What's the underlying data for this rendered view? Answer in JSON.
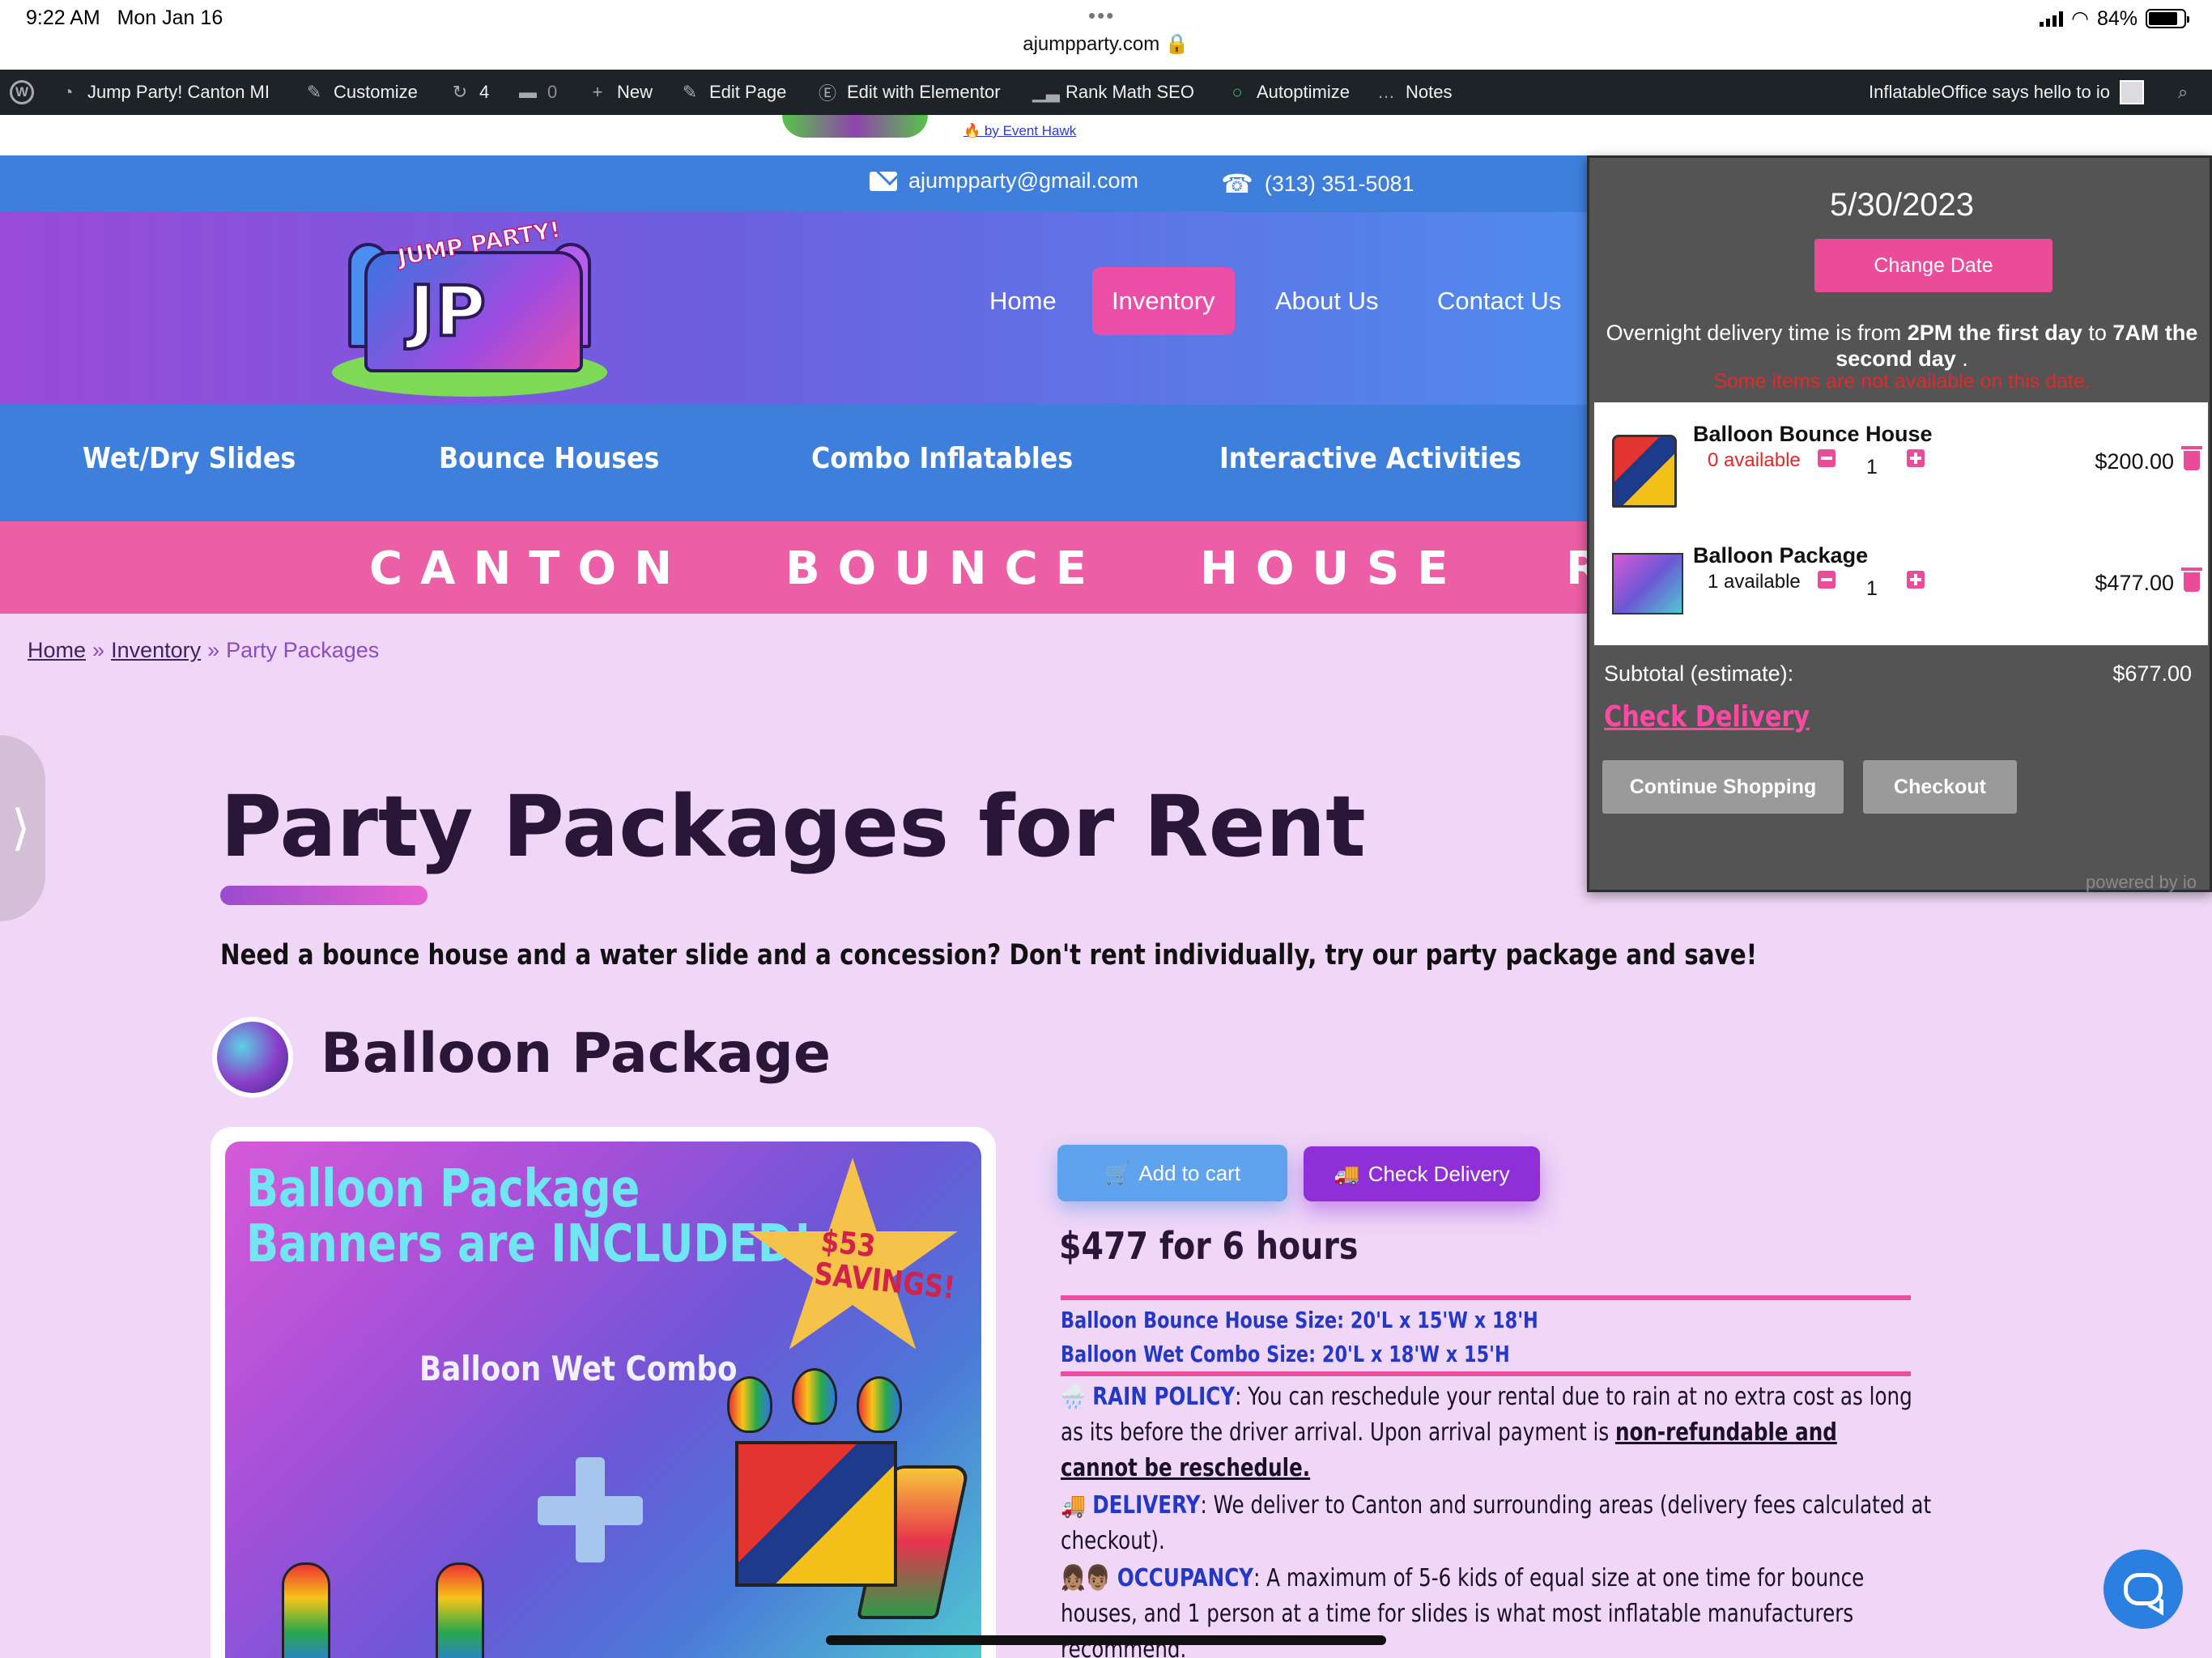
{
  "status_bar": {
    "time": "9:22 AM",
    "date": "Mon Jan 16",
    "url": "ajumpparty.com 🔒",
    "battery": "84%",
    "battery_level": 0.84
  },
  "admin_bar": {
    "site_name": "Jump Party! Canton MI",
    "customize": "Customize",
    "updates_count": "4",
    "comments_count": "0",
    "new": "New",
    "edit_page": "Edit Page",
    "edit_elementor": "Edit with Elementor",
    "rank_math": "Rank Math SEO",
    "autoptimize": "Autoptimize",
    "notes": "Notes",
    "greeting": "InflatableOffice says hello to io"
  },
  "event_hawk": {
    "link": "🔥 by Event Hawk"
  },
  "contact": {
    "email": "ajumpparty@gmail.com",
    "phone": "(313) 351-5081"
  },
  "logo": {
    "arch_text": "JUMP PARTY!",
    "letters": "JP"
  },
  "nav": [
    {
      "label": "Home"
    },
    {
      "label": "Inventory"
    },
    {
      "label": "About Us"
    },
    {
      "label": "Contact Us"
    }
  ],
  "categories": [
    {
      "label": "Wet/Dry Slides"
    },
    {
      "label": "Bounce Houses"
    },
    {
      "label": "Combo Inflatables"
    },
    {
      "label": "Interactive Activities"
    }
  ],
  "marquee": [
    "CANTON",
    "BOUNCE",
    "HOUSE",
    "R"
  ],
  "breadcrumb": {
    "home": "Home",
    "sep1": "»",
    "inventory": "Inventory",
    "sep2": "»",
    "current": "Party Packages"
  },
  "side_tab": {
    "chevron": "⟩"
  },
  "page": {
    "title": "Party Packages for Rent",
    "intro": "Need a bounce house and a water slide and a concession?  Don't rent individually, try our party package and save!"
  },
  "package": {
    "title": "Balloon Package",
    "image": {
      "line1": "Balloon Package",
      "line2": "Banners are INCLUDED!",
      "savings1": "$53",
      "savings2": "SAVINGS!",
      "combo": "Balloon Wet Combo"
    },
    "add_to_cart": "Add to cart",
    "check_delivery": "Check Delivery",
    "price": "$477 for 6 hours",
    "size1": "Balloon Bounce House Size: 20'L x 15'W x 18'H",
    "size2": "Balloon Wet Combo Size: 20'L x 18'W x 15'H",
    "rain_key": "🌧️ RAIN POLICY",
    "rain_text": ": You can reschedule your rental due to rain at no extra cost as long",
    "rain_text2": "as its before the driver arrival. Upon arrival payment is ",
    "rain_bold1": "non-refundable and",
    "rain_bold2": "cannot be reschedule.",
    "delivery_key": "🚚 DELIVERY",
    "delivery_text": ": We deliver to Canton and surrounding areas (delivery fees calculated at",
    "delivery_text2": "checkout).",
    "occupancy_key": "👧🏽👦🏽 OCCUPANCY",
    "occupancy_text": ": A maximum of 5-6 kids of equal size at one time for bounce",
    "occupancy_text2": "houses, and 1 person at a time for slides is what most inflatable manufacturers",
    "occupancy_text3": "recommend."
  },
  "cart": {
    "date": "5/30/2023",
    "change_date": "Change Date",
    "info_line1_a": "Overnight delivery time is from ",
    "info_line1_b": "2PM the first day",
    "info_line1_c": " to ",
    "info_line1_d": "7AM the",
    "info_line2_a": "second day",
    "info_line2_b": " .",
    "warning": "Some items are not available on this date.",
    "items": [
      {
        "name": "Balloon Bounce House",
        "availability": "0 available",
        "qty": "1",
        "price": "$200.00",
        "avail_color": "#e02a2a"
      },
      {
        "name": "Balloon Package",
        "availability": "1 available",
        "qty": "1",
        "price": "$477.00",
        "avail_color": "#111111"
      }
    ],
    "subtotal_label": "Subtotal (estimate):",
    "subtotal_value": "$677.00",
    "check_delivery": "Check Delivery",
    "continue_shopping": "Continue Shopping",
    "checkout": "Checkout",
    "powered": "powered by io"
  },
  "colors": {
    "accent_pink": "#ec5ea5",
    "nav_blue": "#3f7fdc",
    "page_bg": "#f0d6f7",
    "purple_button": "#8f2fd7"
  }
}
